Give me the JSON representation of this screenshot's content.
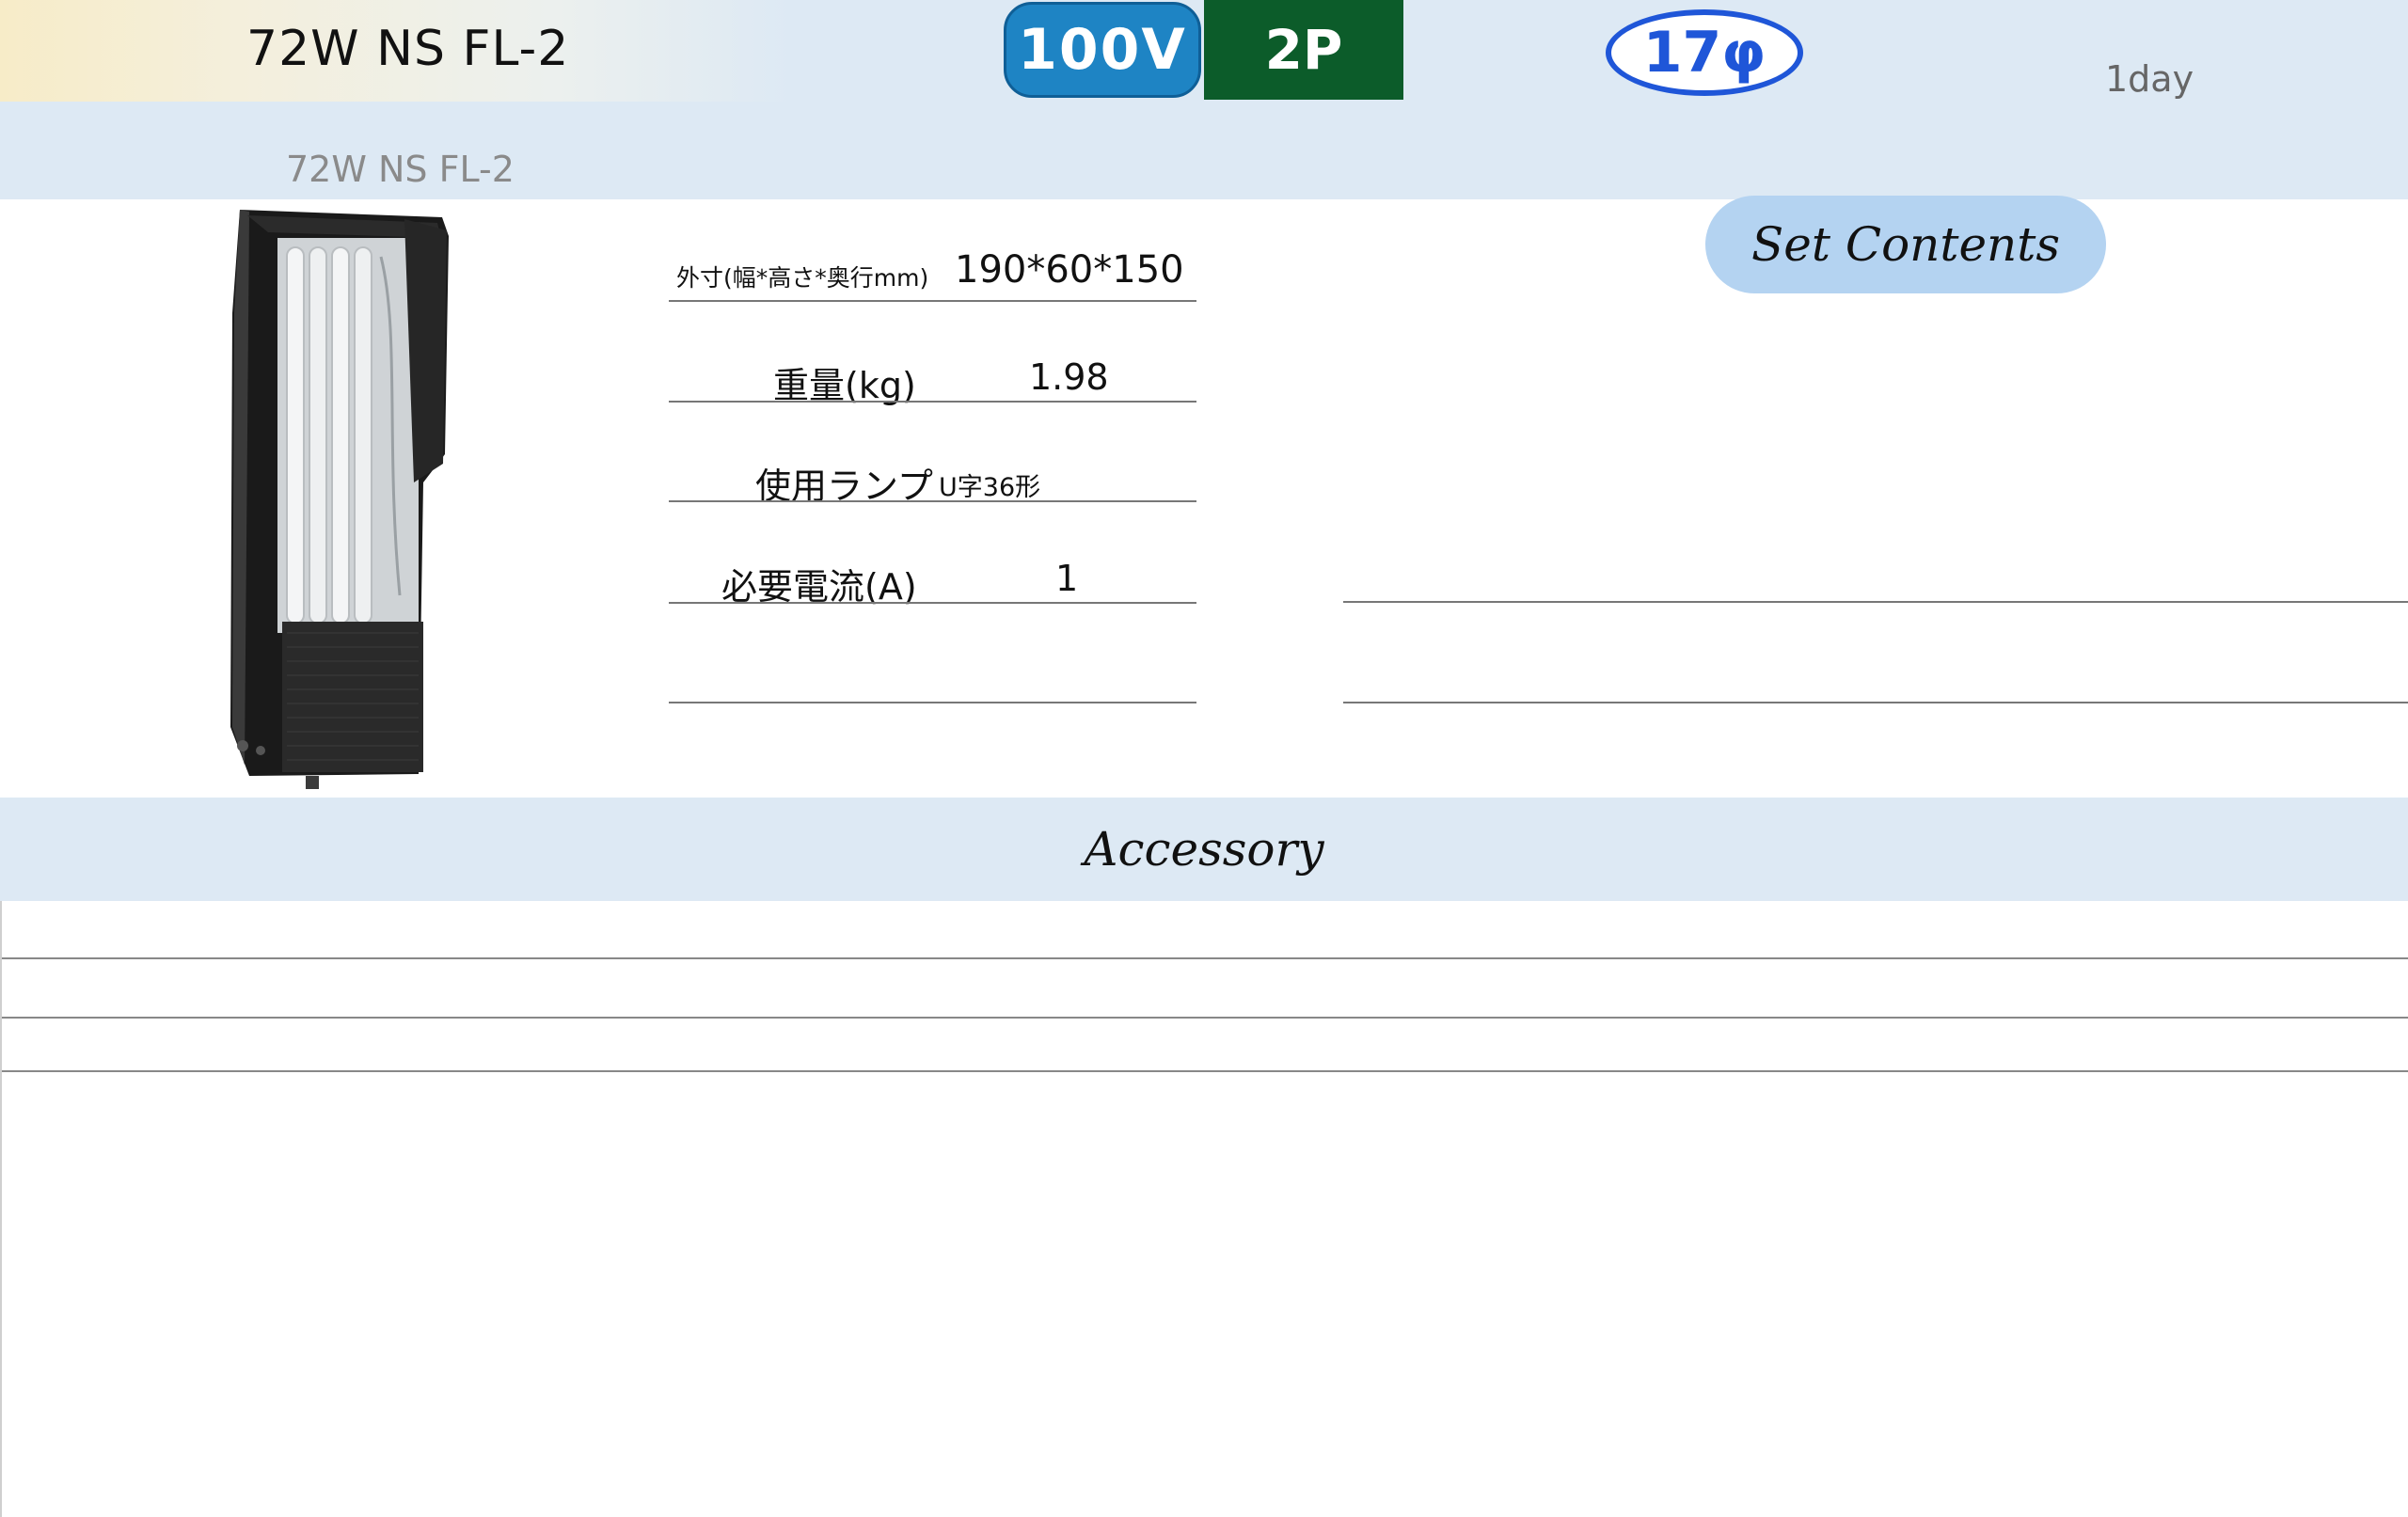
{
  "header": {
    "model_title": "72W NS FL-2",
    "model_subtitle": "72W NS FL-2",
    "voltage_badge": "100V",
    "plug_badge": "2P",
    "diameter_badge": "17φ",
    "rental_period": "1day"
  },
  "specs": [
    {
      "label": "外寸(幅*高さ*奥行mm)",
      "value": "190*60*150"
    },
    {
      "label": "重量(kg)",
      "value": "1.98"
    },
    {
      "label": "使用ランプ",
      "value": "U字36形"
    },
    {
      "label": "必要電流(A)",
      "value": "1"
    }
  ],
  "set_contents": {
    "label": "Set Contents"
  },
  "accessory": {
    "label": "Accessory"
  },
  "colors": {
    "header_band": "#dde9f4",
    "voltage_badge": "#1e84c4",
    "plug_badge": "#0c5c2a",
    "diameter_ring": "#1f56d8",
    "set_contents_pill": "#b4d3f1"
  }
}
